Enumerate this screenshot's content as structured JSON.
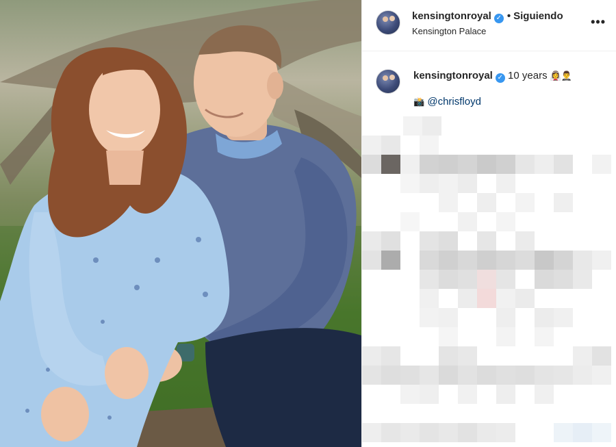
{
  "post": {
    "header": {
      "username": "kensingtonroyal",
      "verified_glyph": "✓",
      "separator": "•",
      "follow_status": "Siguiendo",
      "location": "Kensington Palace",
      "more_glyph": "•••"
    },
    "caption": {
      "username": "kensingtonroyal",
      "text": "10 years",
      "emojis": "👰‍♀️🤵‍♂️",
      "camera_emoji": "📸",
      "mention": "@chrisfloyd"
    }
  },
  "icons": {
    "avatar": "avatar-icon",
    "verified": "verified-badge-icon",
    "more": "more-options-icon"
  },
  "colors": {
    "verified_blue": "#3897f0",
    "mention_blue": "#00376b",
    "text": "#262626",
    "divider": "#efefef"
  }
}
